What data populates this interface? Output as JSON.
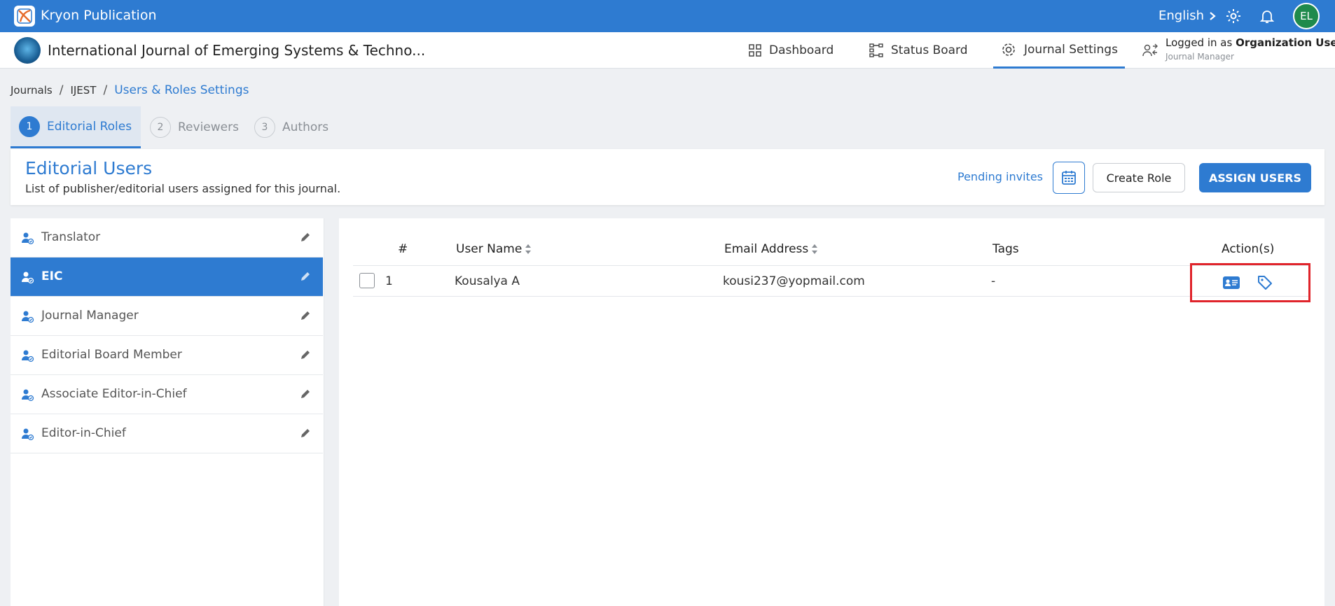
{
  "app": {
    "title": "Kryon Publication",
    "language": "English",
    "user_initials": "EL"
  },
  "journal": {
    "title": "International Journal of Emerging Systems & Techno..."
  },
  "nav": [
    {
      "label": "Dashboard",
      "icon": "dashboard-icon"
    },
    {
      "label": "Status Board",
      "icon": "status-board-icon"
    },
    {
      "label": "Journal Settings",
      "icon": "gear-icon"
    }
  ],
  "logged_in": {
    "prefix": "Logged in as",
    "name": "Organization User",
    "role": "Journal Manager"
  },
  "breadcrumb": {
    "items": [
      "Journals",
      "IJEST"
    ],
    "current": "Users & Roles Settings"
  },
  "tabs": [
    {
      "num": "1",
      "label": "Editorial Roles"
    },
    {
      "num": "2",
      "label": "Reviewers"
    },
    {
      "num": "3",
      "label": "Authors"
    }
  ],
  "card": {
    "title": "Editorial Users",
    "subtitle": "List of publisher/editorial users assigned for this journal.",
    "pending_label": "Pending invites",
    "create_label": "Create Role",
    "assign_label": "ASSIGN USERS"
  },
  "roles": [
    {
      "label": "Translator"
    },
    {
      "label": "EIC"
    },
    {
      "label": "Journal Manager"
    },
    {
      "label": "Editorial Board Member"
    },
    {
      "label": "Associate Editor-in-Chief"
    },
    {
      "label": "Editor-in-Chief"
    }
  ],
  "table": {
    "headers": {
      "num": "#",
      "user_name": "User Name",
      "email": "Email Address",
      "tags": "Tags",
      "actions": "Action(s)"
    },
    "rows": [
      {
        "num": "1",
        "user_name": "Kousalya A",
        "email": "kousi237@yopmail.com",
        "tags": "-"
      }
    ]
  },
  "colors": {
    "primary": "#2e7bd1",
    "highlight": "#e0242b",
    "avatar": "#1f8a4c"
  }
}
